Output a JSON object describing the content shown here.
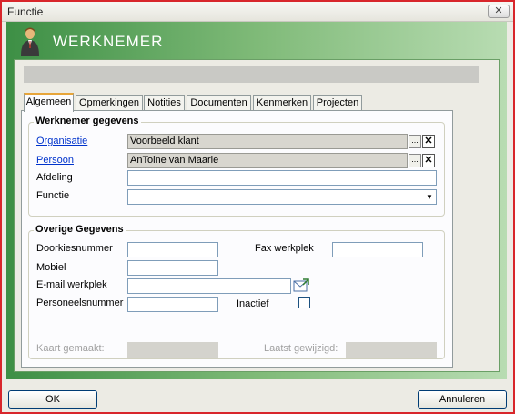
{
  "window": {
    "title": "Functie",
    "close_label": "✕"
  },
  "header": {
    "title": "WERKNEMER",
    "icon": "person-icon"
  },
  "tabs": [
    {
      "label": "Algemeen"
    },
    {
      "label": "Opmerkingen"
    },
    {
      "label": "Notities"
    },
    {
      "label": "Documenten"
    },
    {
      "label": "Kenmerken"
    },
    {
      "label": "Projecten"
    }
  ],
  "werknemer": {
    "title": "Werknemer gegevens",
    "organisatie": {
      "label": "Organisatie",
      "value": "Voorbeeld klant"
    },
    "persoon": {
      "label": "Persoon",
      "value": "AnToine van Maarle"
    },
    "afdeling": {
      "label": "Afdeling",
      "value": ""
    },
    "functie": {
      "label": "Functie",
      "value": ""
    },
    "browse_label": "...",
    "clear_label": "✕",
    "dropdown_arrow": "▼"
  },
  "overige": {
    "title": "Overige Gegevens",
    "doorkiesnummer": {
      "label": "Doorkiesnummer",
      "value": ""
    },
    "fax": {
      "label": "Fax werkplek",
      "value": ""
    },
    "mobiel": {
      "label": "Mobiel",
      "value": ""
    },
    "email": {
      "label": "E-mail werkplek",
      "value": ""
    },
    "personeelsnummer": {
      "label": "Personeelsnummer",
      "value": ""
    },
    "inactief": {
      "label": "Inactief",
      "checked": false
    },
    "kaart_gemaakt": {
      "label": "Kaart gemaakt:",
      "value": ""
    },
    "laatst_gewijzigd": {
      "label": "Laatst gewijzigd:",
      "value": ""
    }
  },
  "buttons": {
    "ok": "OK",
    "cancel": "Annuleren"
  }
}
